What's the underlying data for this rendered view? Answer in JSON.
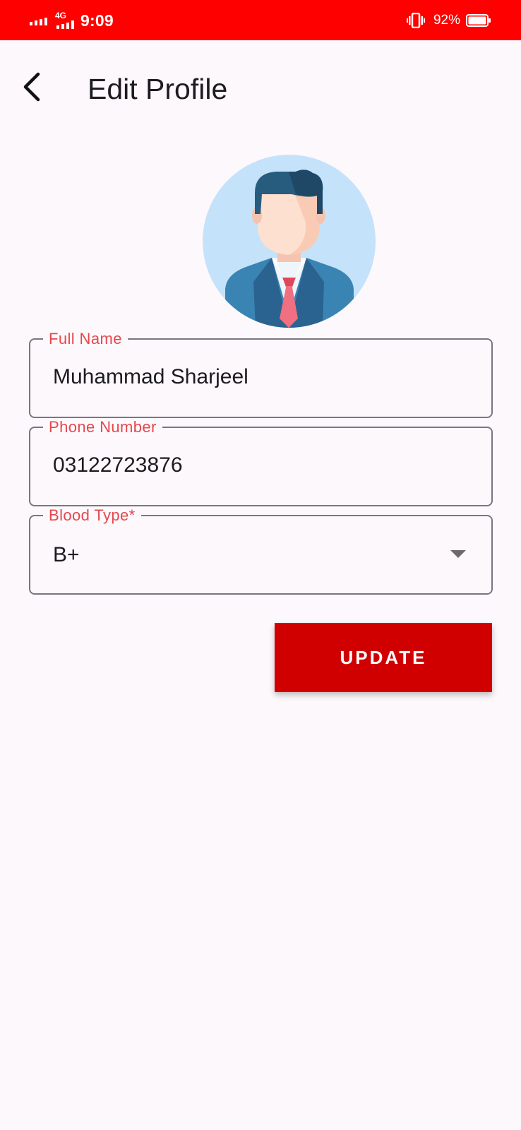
{
  "status_bar": {
    "network": "4G",
    "time": "9:09",
    "battery": "92%"
  },
  "header": {
    "title": "Edit Profile",
    "back_icon": "arrow-back-icon"
  },
  "avatar": {
    "icon": "businessman-avatar-icon"
  },
  "form": {
    "full_name": {
      "label": "Full Name",
      "value": "Muhammad Sharjeel"
    },
    "phone": {
      "label": "Phone Number",
      "value": "03122723876"
    },
    "blood_type": {
      "label": "Blood Type*",
      "value": "B+"
    }
  },
  "actions": {
    "update_label": "UPDATE"
  },
  "colors": {
    "status_bar": "#ff0000",
    "accent_label": "#e5484d",
    "button": "#d10000",
    "background": "#fdf8fc"
  }
}
